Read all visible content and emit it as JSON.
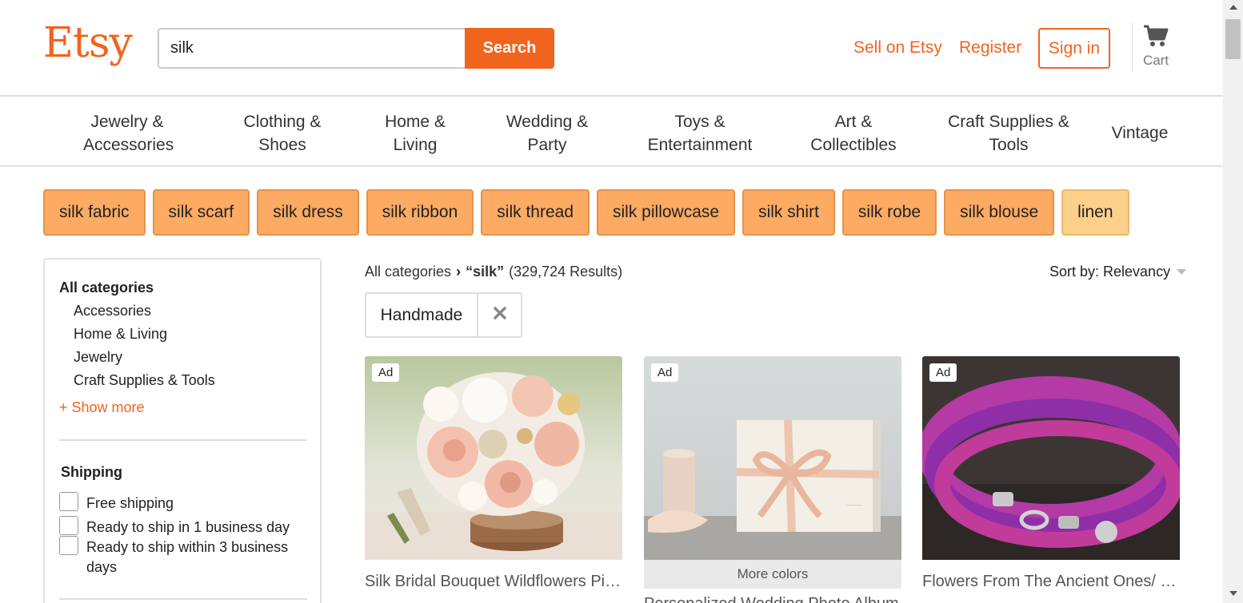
{
  "header": {
    "logo": "Etsy",
    "search_value": "silk",
    "search_button": "Search",
    "sell_link": "Sell on Etsy",
    "register_link": "Register",
    "signin_button": "Sign in",
    "cart_label": "Cart",
    "brand_color": "#f1641e"
  },
  "categories": [
    {
      "line1": "Jewelry &",
      "line2": "Accessories"
    },
    {
      "line1": "Clothing &",
      "line2": "Shoes"
    },
    {
      "line1": "Home &",
      "line2": "Living"
    },
    {
      "line1": "Wedding &",
      "line2": "Party"
    },
    {
      "line1": "Toys &",
      "line2": "Entertainment"
    },
    {
      "line1": "Art &",
      "line2": "Collectibles"
    },
    {
      "line1": "Craft Supplies &",
      "line2": "Tools"
    },
    {
      "line1": "Vintage",
      "line2": ""
    }
  ],
  "related_searches": [
    "silk fabric",
    "silk scarf",
    "silk dress",
    "silk ribbon",
    "silk thread",
    "silk pillowcase",
    "silk shirt",
    "silk robe",
    "silk blouse",
    "linen"
  ],
  "sidebar": {
    "title": "All categories",
    "items": [
      "Accessories",
      "Home & Living",
      "Jewelry",
      "Craft Supplies & Tools"
    ],
    "show_more": "+ Show more",
    "shipping_title": "Shipping",
    "shipping_options": [
      "Free shipping",
      "Ready to ship in 1 business day",
      "Ready to ship within 3 business days"
    ]
  },
  "results": {
    "breadcrumb_root": "All categories",
    "query": "“silk”",
    "count": "(329,724 Results)",
    "sort_label": "Sort by: Relevancy",
    "active_filter": "Handmade"
  },
  "listings": [
    {
      "badge": "Ad",
      "title": "Silk Bridal Bouquet Wildflowers Pink Champagne Ivory",
      "more_colors": ""
    },
    {
      "badge": "Ad",
      "title": "Personalized Wedding Photo Album",
      "more_colors": "More colors"
    },
    {
      "badge": "Ad",
      "title": "Flowers From The Ancient Ones/ knitted silk bracelet",
      "more_colors": ""
    }
  ]
}
